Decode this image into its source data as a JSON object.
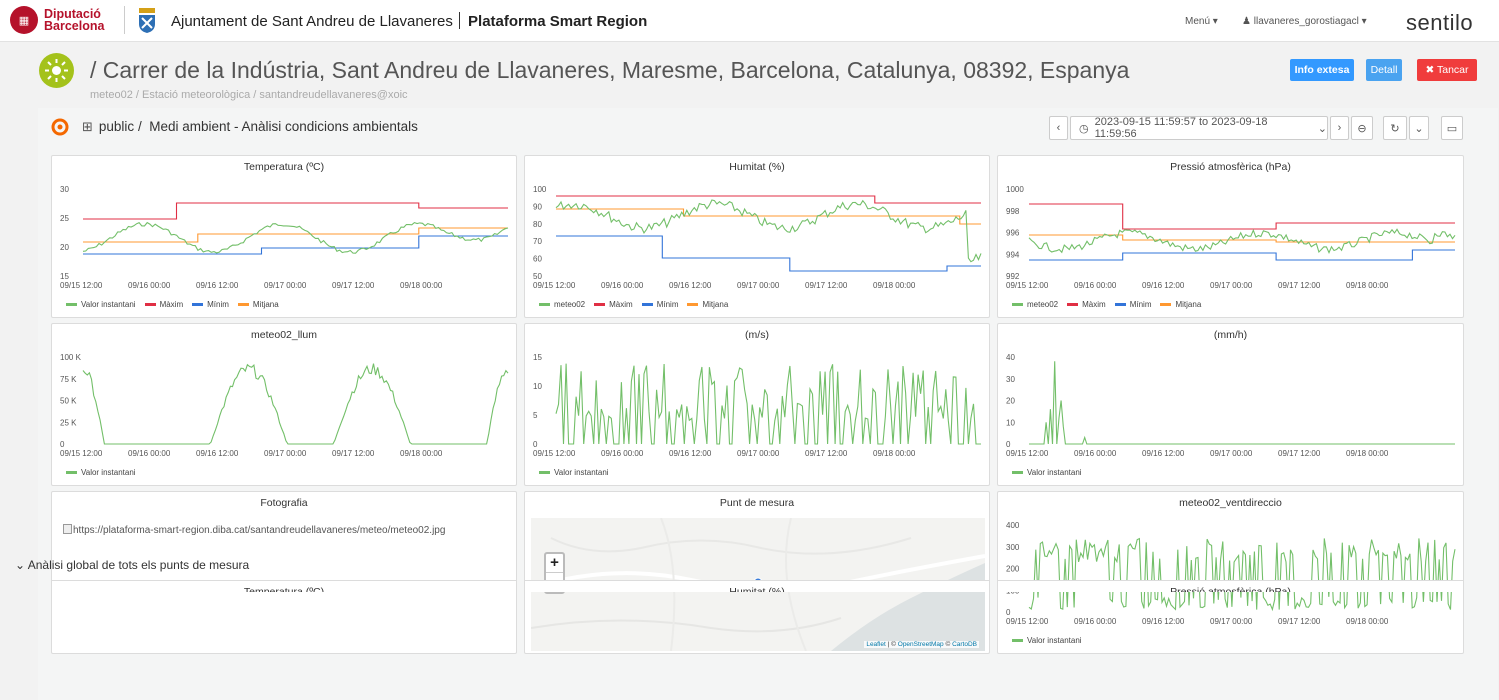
{
  "topbar": {
    "diba_logo_line1": "Diputació",
    "diba_logo_line2": "Barcelona",
    "council": "Ajuntament de Sant Andreu de Llavaneres",
    "platform": "Plataforma Smart Region",
    "menu": "Menú",
    "user": "llavaneres_gorostiagacl",
    "brand": "sentilo"
  },
  "header": {
    "address": "/ Carrer de la Indústria, Sant Andreu de Llavaneres, Maresme, Barcelona, Catalunya, 08392, Espanya",
    "subtitle": "meteo02 / Estació meteorològica / santandreudellavaneres@xoic",
    "btn_info": "Info extesa",
    "btn_detall": "Detall",
    "btn_tancar": "✖ Tancar"
  },
  "dashboard": {
    "folder": "public",
    "title": "Medi ambient - Anàlisi condicions ambientals",
    "time_range": "2023-09-15 11:59:57 to 2023-09-18 11:59:56",
    "section_label": "Anàlisi global de tots els punts de mesura"
  },
  "colors": {
    "green": "#73bf69",
    "red": "#e02f44",
    "blue": "#3274d9",
    "orange": "#ff9830"
  },
  "x_ticks": [
    "09/15 12:00",
    "09/16 00:00",
    "09/16 12:00",
    "09/17 00:00",
    "09/17 12:00",
    "09/18 00:00"
  ],
  "panels": {
    "temp": {
      "title": "Temperatura (ºC)",
      "y_ticks": [
        "30",
        "25",
        "20",
        "15"
      ],
      "legend": [
        "Valor instantani",
        "Màxim",
        "Mínim",
        "Mitjana"
      ]
    },
    "hum": {
      "title": "Humitat (%)",
      "y_ticks": [
        "100",
        "90",
        "80",
        "70",
        "60",
        "50"
      ],
      "legend": [
        "meteo02",
        "Màxim",
        "Mínim",
        "Mitjana"
      ]
    },
    "press": {
      "title": "Pressió atmosfèrica (hPa)",
      "y_ticks": [
        "1000",
        "998",
        "996",
        "994",
        "992"
      ],
      "legend": [
        "meteo02",
        "Màxim",
        "Mínim",
        "Mitjana"
      ]
    },
    "llum": {
      "title": "meteo02_llum",
      "y_ticks": [
        "100 K",
        "75 K",
        "50 K",
        "25 K",
        "0"
      ],
      "legend": [
        "Valor instantani"
      ]
    },
    "wind": {
      "title": "(m/s)",
      "y_ticks": [
        "15",
        "10",
        "5",
        "0"
      ],
      "legend": [
        "Valor instantani"
      ]
    },
    "rain": {
      "title": "(mm/h)",
      "y_ticks": [
        "40",
        "30",
        "20",
        "10",
        "0"
      ],
      "legend": [
        "Valor instantani"
      ]
    },
    "foto": {
      "title": "Fotografia",
      "alt": "https://plataforma-smart-region.diba.cat/santandreudellavaneres/meteo/meteo02.jpg"
    },
    "map": {
      "title": "Punt de mesura",
      "zoom_in": "+",
      "zoom_out": "−",
      "attr_leaflet": "Leaflet",
      "attr_sep1": " | © ",
      "attr_osm": "OpenStreetMap",
      "attr_sep2": " © ",
      "attr_carto": "CartoDB"
    },
    "dir": {
      "title": "meteo02_ventdireccio",
      "y_ticks": [
        "400",
        "300",
        "200",
        "100",
        "0"
      ],
      "legend": [
        "Valor instantani"
      ]
    }
  },
  "bottom_titles": [
    "Temperatura (ºC)",
    "Humitat (%)",
    "Pressió atmosfèrica (hPa)"
  ]
}
